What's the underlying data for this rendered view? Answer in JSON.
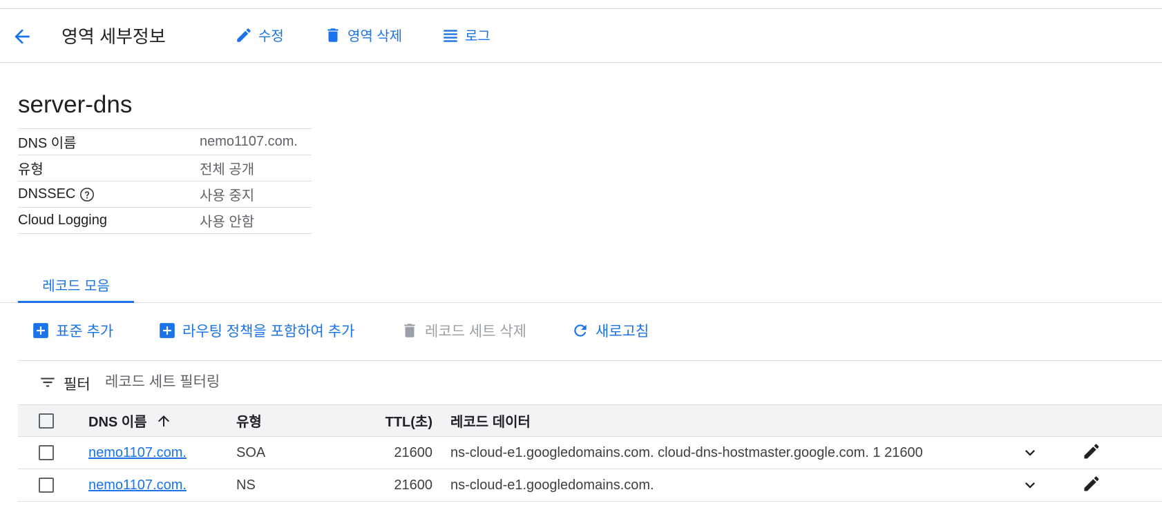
{
  "header": {
    "title": "영역 세부정보",
    "edit_label": "수정",
    "delete_zone_label": "영역 삭제",
    "logs_label": "로그"
  },
  "zone": {
    "name": "server-dns",
    "details": [
      {
        "key": "DNS 이름",
        "value": "nemo1107.com."
      },
      {
        "key": "유형",
        "value": "전체 공개"
      },
      {
        "key": "DNSSEC",
        "value": "사용 중지"
      },
      {
        "key": "Cloud Logging",
        "value": "사용 안함"
      }
    ]
  },
  "tabs": {
    "recordsets_label": "레코드 모음"
  },
  "toolbar": {
    "add_standard_label": "표준 추가",
    "add_with_routing_label": "라우팅 정책을 포함하여 추가",
    "delete_recordset_label": "레코드 세트 삭제",
    "refresh_label": "새로고침"
  },
  "filter": {
    "label": "필터",
    "placeholder": "레코드 세트 필터링"
  },
  "table": {
    "columns": {
      "dns_name": "DNS 이름",
      "type": "유형",
      "ttl": "TTL(초)",
      "data": "레코드 데이터"
    },
    "rows": [
      {
        "dns_name": "nemo1107.com.",
        "type": "SOA",
        "ttl": "21600",
        "data": "ns-cloud-e1.googledomains.com. cloud-dns-hostmaster.google.com. 1 21600"
      },
      {
        "dns_name": "nemo1107.com.",
        "type": "NS",
        "ttl": "21600",
        "data": "ns-cloud-e1.googledomains.com."
      }
    ]
  },
  "colors": {
    "accent": "#1a73e8",
    "text": "#202124",
    "muted": "#5f6368",
    "disabled": "#9aa0a6",
    "divider": "#dadce0",
    "header_bg": "#f1f3f4"
  },
  "icons": [
    "arrow-back-icon",
    "pencil-icon",
    "trash-icon",
    "list-icon",
    "help-icon",
    "add-box-icon",
    "refresh-icon",
    "filter-icon",
    "arrow-up-icon",
    "chevron-down-icon"
  ]
}
